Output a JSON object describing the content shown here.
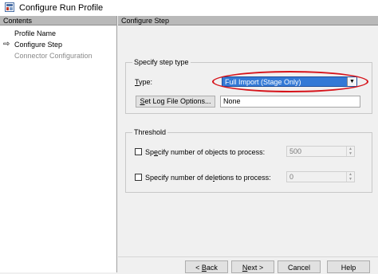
{
  "window": {
    "title": "Configure Run Profile"
  },
  "left_panel": {
    "header": "Contents",
    "items": [
      {
        "label": "Profile Name",
        "state": "normal"
      },
      {
        "label": "Configure Step",
        "state": "current"
      },
      {
        "label": "Connector Configuration",
        "state": "disabled"
      }
    ],
    "current_marker": "⇨"
  },
  "right_panel": {
    "header": "Configure Step",
    "step_type": {
      "legend": "Specify step type",
      "type_label_prefix": "T",
      "type_label_rest": "ype:",
      "type_value": "Full Import (Stage Only)",
      "log_button_prefix": "S",
      "log_button_rest": "et Log File Options...",
      "log_value": "None"
    },
    "threshold": {
      "legend": "Threshold",
      "objects_label_pre": "Sp",
      "objects_label_underline": "e",
      "objects_label_post": "cify number of objects to process:",
      "objects_value": "500",
      "deletions_label_pre": "Specify number of de",
      "deletions_label_underline": "l",
      "deletions_label_post": "etions to process:",
      "deletions_value": "0"
    }
  },
  "buttons": {
    "back_arrow": "<",
    "back_underline": "B",
    "back_rest": "ack",
    "next_underline": "N",
    "next_rest": "ext",
    "next_arrow": ">",
    "cancel": "Cancel",
    "help": "Help"
  },
  "colors": {
    "accent_selection": "#3379d6",
    "highlight_ring": "#d6131a",
    "panel_header": "#b9b9b9"
  }
}
